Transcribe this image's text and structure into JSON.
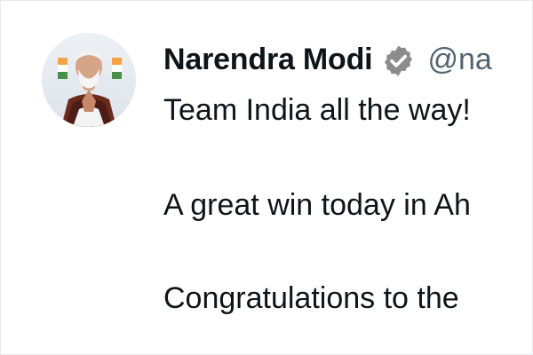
{
  "author": {
    "display_name": "Narendra Modi",
    "handle": "@na",
    "verified": true,
    "verified_badge_color": "#8c8c8c"
  },
  "tweet": {
    "lines": [
      "Team India all the way!",
      "A great win today in Ah",
      "Congratulations to the"
    ]
  },
  "colors": {
    "background": "#ffffff",
    "text": "#0f1419",
    "muted_text": "#536471"
  }
}
